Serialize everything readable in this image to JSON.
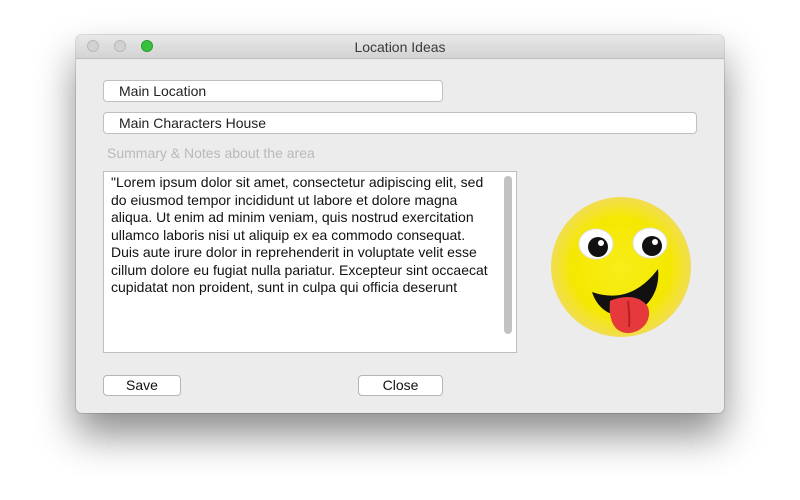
{
  "window": {
    "title": "Location Ideas"
  },
  "fields": {
    "main_location": "Main Location",
    "main_characters_house": "Main Characters House"
  },
  "notes": {
    "label": "Summary & Notes about the area",
    "text": "\"Lorem ipsum dolor sit amet, consectetur adipiscing elit, sed do eiusmod tempor incididunt ut labore et dolore magna aliqua. Ut enim ad minim veniam, quis nostrud exercitation ullamco laboris nisi ut aliquip ex ea commodo consequat. Duis aute irure dolor in reprehenderit in voluptate velit esse cillum dolore eu fugiat nulla pariatur. Excepteur sint occaecat cupidatat non proident, sunt in culpa qui officia deserunt"
  },
  "buttons": {
    "save": "Save",
    "close": "Close"
  },
  "colors": {
    "zoom_button": "#38c13d",
    "emoji_face": "#f5e800",
    "emoji_tongue": "#e5393c"
  },
  "icons": {
    "emoji": "tongue-out-emoji-icon"
  }
}
